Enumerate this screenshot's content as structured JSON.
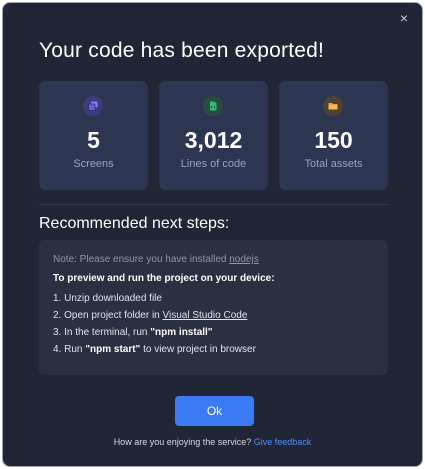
{
  "dialog": {
    "title": "Your code has been exported!",
    "close_symbol": "×"
  },
  "stats": [
    {
      "icon": "screens-icon",
      "value": "5",
      "label": "Screens",
      "color": "#6a5cf5"
    },
    {
      "icon": "file-code-icon",
      "value": "3,012",
      "label": "Lines of code",
      "color": "#2fbf71"
    },
    {
      "icon": "folder-icon",
      "value": "150",
      "label": "Total assets",
      "color": "#f0a33c"
    }
  ],
  "steps": {
    "heading": "Recommended next steps:",
    "note_prefix": "Note: Please ensure you have installed ",
    "note_link": "nodejs",
    "intro": "To preview and run the project on your device:",
    "step1": "1. Unzip downloaded file",
    "step2_prefix": "2. Open project folder in ",
    "step2_link": "Visual Studio Code",
    "step3_prefix": "3. In the terminal, run ",
    "step3_code": "\"npm install\"",
    "step4_prefix": "4. Run ",
    "step4_code": "\"npm start\"",
    "step4_suffix": " to view project in browser"
  },
  "actions": {
    "ok_label": "Ok",
    "feedback_prompt": "How are you enjoying the service? ",
    "feedback_link": "Give feedback"
  },
  "colors": {
    "background": "#212637",
    "card": "#2d3650",
    "accent": "#3b7cf5"
  }
}
